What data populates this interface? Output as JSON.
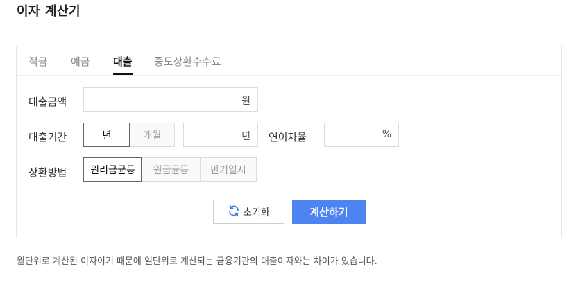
{
  "title": "이자 계산기",
  "tabs": [
    {
      "label": "적금",
      "active": false
    },
    {
      "label": "예금",
      "active": false
    },
    {
      "label": "대출",
      "active": true
    },
    {
      "label": "중도상환수수료",
      "active": false
    }
  ],
  "form": {
    "amount": {
      "label": "대출금액",
      "value": "",
      "unit": "원"
    },
    "period": {
      "label": "대출기간",
      "options": [
        "년",
        "개월"
      ],
      "selected": "년",
      "value": "",
      "unit": "년"
    },
    "rate": {
      "label": "연이자율",
      "value": "",
      "unit": "%"
    },
    "method": {
      "label": "상환방법",
      "options": [
        "원리금균등",
        "원금균등",
        "만기일시"
      ],
      "selected": "원리금균등"
    }
  },
  "buttons": {
    "reset": "초기화",
    "calculate": "계산하기"
  },
  "note": "월단위로 계산된 이자이기 때문에 일단위로 계산되는 금융기관의 대출이자와는 차이가 있습니다.",
  "colors": {
    "accent": "#4e84f0",
    "refresh_icon": "#3d7bdc"
  }
}
